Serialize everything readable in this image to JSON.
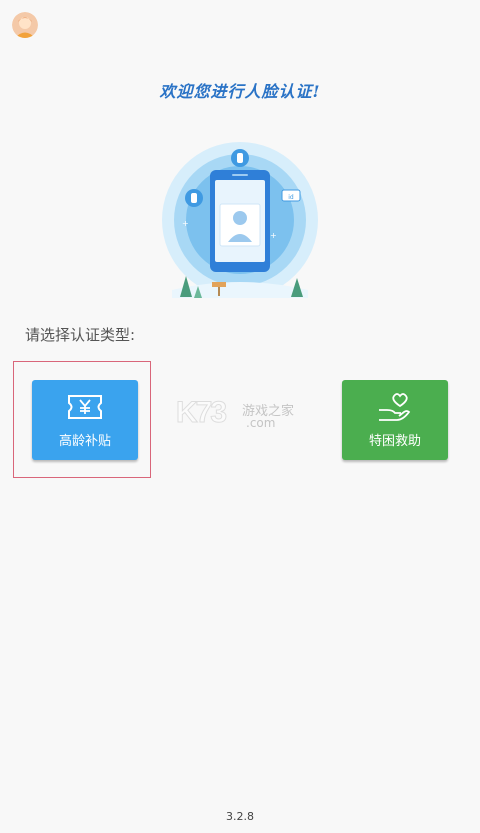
{
  "header": {
    "avatar_icon": "user-avatar-icon"
  },
  "welcome": {
    "title": "欢迎您进行人脸认证!"
  },
  "illustration": {
    "icon": "face-recognition-phone-illustration",
    "badge": "id"
  },
  "selection": {
    "prompt": "请选择认证类型:",
    "options": [
      {
        "label": "高龄补贴",
        "icon": "yuan-ticket-icon",
        "color": "#3aa3ee"
      },
      {
        "label": "特困救助",
        "icon": "heart-hand-icon",
        "color": "#4bae4f"
      }
    ]
  },
  "watermark": {
    "brand": "K73",
    "line1": "游戏之家",
    "line2": ".com"
  },
  "footer": {
    "version": "3.2.8"
  }
}
